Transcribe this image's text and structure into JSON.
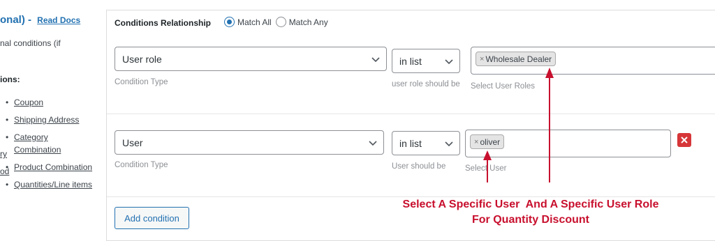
{
  "sidebar": {
    "title_fragment": "onal) -",
    "read_docs": "Read Docs",
    "text_fragment": "nal conditions (if",
    "heading_fragment": "ions:",
    "items": [
      {
        "label": "Coupon"
      },
      {
        "label": "Shipping Address"
      },
      {
        "label": "Category Combination"
      },
      {
        "label": "Product Combination"
      },
      {
        "label": "Quantities/Line items"
      }
    ],
    "clipped_fragment_1": "ry",
    "clipped_fragment_2": "od"
  },
  "conditions": {
    "relationship_label": "Conditions Relationship",
    "options": [
      {
        "label": "Match All",
        "checked": true
      },
      {
        "label": "Match Any",
        "checked": false
      }
    ],
    "rows": [
      {
        "type_value": "User role",
        "type_hint": "Condition Type",
        "operator_value": "in list",
        "operator_hint": "user role should be",
        "tags": [
          "Wholesale Dealer"
        ],
        "tag_hint": "Select User Roles",
        "removable": false
      },
      {
        "type_value": "User",
        "type_hint": "Condition Type",
        "operator_value": "in list",
        "operator_hint": "User should be",
        "tags": [
          "oliver"
        ],
        "tag_hint": "Select User",
        "removable": true
      }
    ],
    "add_button": "Add condition"
  },
  "annotation": {
    "line1": "Select A Specific User  And A Specific User Role",
    "line2": "For Quantity Discount",
    "color": "#c8102e"
  },
  "colors": {
    "accent": "#2271b1",
    "danger": "#d63638"
  }
}
